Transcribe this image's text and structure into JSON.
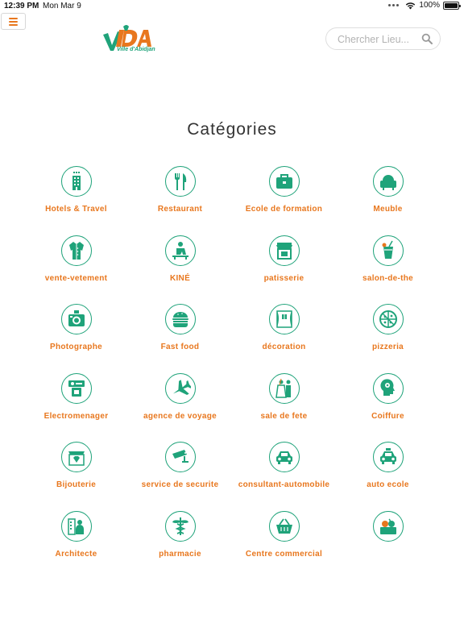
{
  "status_bar": {
    "time": "12:39 PM",
    "date": "Mon Mar 9",
    "battery": "100%",
    "battery_level": 1.0
  },
  "header": {
    "menu_icon": "hamburger-icon",
    "logo": {
      "text": "VDA",
      "subtitle": "Ville d'Abidjan"
    },
    "search": {
      "placeholder": "Chercher Lieu...",
      "value": "",
      "icon": "search-icon"
    }
  },
  "page": {
    "title": "Catégories"
  },
  "colors": {
    "accent": "#e8771e",
    "green": "#1fa37a"
  },
  "categories": [
    {
      "label": "Hotels & Travel",
      "icon": "hotel-building-icon"
    },
    {
      "label": "Restaurant",
      "icon": "fork-knife-icon"
    },
    {
      "label": "Ecole de formation",
      "icon": "briefcase-icon"
    },
    {
      "label": "Meuble",
      "icon": "armchair-icon"
    },
    {
      "label": "vente-vetement",
      "icon": "coat-icon"
    },
    {
      "label": "KINÉ",
      "icon": "physiotherapy-icon"
    },
    {
      "label": "patisserie",
      "icon": "pastry-shop-icon"
    },
    {
      "label": "salon-de-the",
      "icon": "drink-glass-icon"
    },
    {
      "label": "Photographe",
      "icon": "camera-icon"
    },
    {
      "label": "Fast food",
      "icon": "burger-icon"
    },
    {
      "label": "décoration",
      "icon": "window-curtain-icon"
    },
    {
      "label": "pizzeria",
      "icon": "pizza-icon"
    },
    {
      "label": "Electromenager",
      "icon": "appliance-icon"
    },
    {
      "label": "agence de voyage",
      "icon": "airplane-icon"
    },
    {
      "label": "sale de fete",
      "icon": "wedding-couple-icon"
    },
    {
      "label": "Coiffure",
      "icon": "hair-head-icon"
    },
    {
      "label": "Bijouterie",
      "icon": "jewelry-shop-icon"
    },
    {
      "label": "service de securite",
      "icon": "security-camera-icon"
    },
    {
      "label": "consultant-automobile",
      "icon": "car-icon"
    },
    {
      "label": "auto ecole",
      "icon": "taxi-icon"
    },
    {
      "label": "Architecte",
      "icon": "architect-icon"
    },
    {
      "label": "pharmacie",
      "icon": "caduceus-icon"
    },
    {
      "label": "Centre commercial",
      "icon": "shopping-basket-icon"
    },
    {
      "label": "",
      "icon": "market-produce-icon"
    }
  ]
}
